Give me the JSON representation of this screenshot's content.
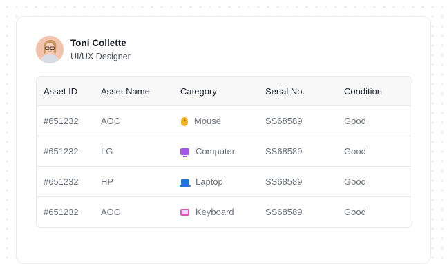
{
  "user": {
    "name": "Toni Collette",
    "role": "UI/UX Designer"
  },
  "table": {
    "columns": [
      "Asset ID",
      "Asset Name",
      "Category",
      "Serial No.",
      "Condition"
    ],
    "rows": [
      {
        "asset_id": "#651232",
        "asset_name": "AOC",
        "category": "Mouse",
        "category_icon": "mouse-icon",
        "serial": "SS68589",
        "condition": "Good"
      },
      {
        "asset_id": "#651232",
        "asset_name": "LG",
        "category": "Computer",
        "category_icon": "computer-icon",
        "serial": "SS68589",
        "condition": "Good"
      },
      {
        "asset_id": "#651232",
        "asset_name": "HP",
        "category": "Laptop",
        "category_icon": "laptop-icon",
        "serial": "SS68589",
        "condition": "Good"
      },
      {
        "asset_id": "#651232",
        "asset_name": "AOC",
        "category": "Keyboard",
        "category_icon": "keyboard-icon",
        "serial": "SS68589",
        "condition": "Good"
      }
    ]
  },
  "colors": {
    "mouse": "#f3b224",
    "computer": "#a456e8",
    "laptop": "#1f74dd",
    "keyboard": "#e454b7"
  }
}
